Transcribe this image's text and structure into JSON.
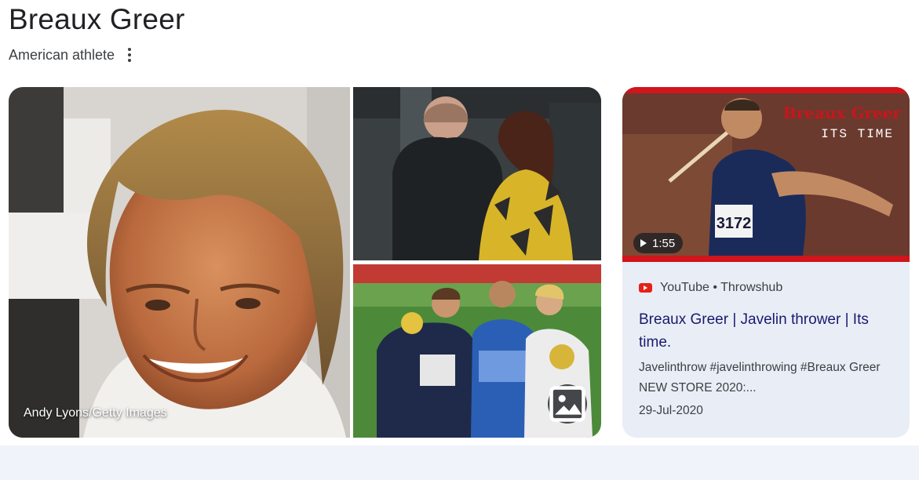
{
  "entity": {
    "title": "Breaux Greer",
    "subtitle": "American athlete"
  },
  "images": {
    "main_credit": "Andy Lyons/Getty Images",
    "tiles": [
      {
        "description": "close-up portrait photo"
      },
      {
        "description": "couple photo"
      },
      {
        "description": "medal podium photo"
      }
    ]
  },
  "video": {
    "duration": "1:55",
    "source": "YouTube • Throwshub",
    "title": "Breaux Greer | Javelin thrower | Its time.",
    "description": "Javelinthrow #javelinthrowing #Breaux Greer NEW STORE 2020:...",
    "date": "29-Jul-2020",
    "thumb_overlay_name": "Breaux Greer",
    "thumb_overlay_tagline": "ITS TIME",
    "thumb_bib": "3172"
  },
  "colors": {
    "youtube_red": "#e62117",
    "title_text": "#1a1a6e",
    "card_bg": "#e9eef6",
    "band_bg": "#f1f3fb"
  },
  "icons": {
    "more": "kebab-vertical",
    "image_search": "image-icon",
    "play": "play-triangle",
    "youtube": "youtube-logo"
  }
}
